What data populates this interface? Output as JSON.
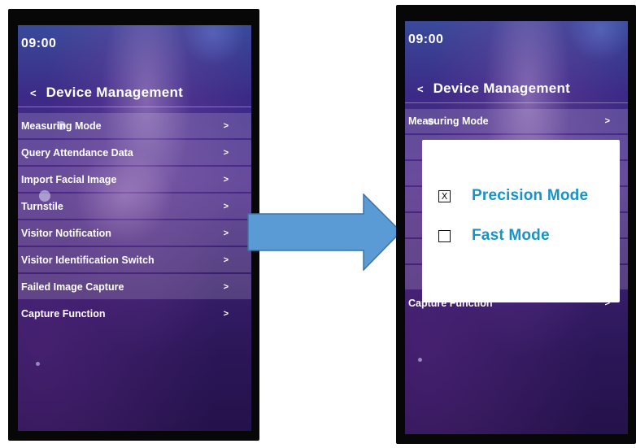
{
  "left_screen": {
    "time": "09:00",
    "back_label": "<",
    "title": "Device Management",
    "menu_items": [
      {
        "label": "Measuring Mode",
        "arrow": ">"
      },
      {
        "label": "Query Attendance Data",
        "arrow": ">"
      },
      {
        "label": "Import Facial Image",
        "arrow": ">"
      },
      {
        "label": "Turnstile",
        "arrow": ">"
      },
      {
        "label": "Visitor Notification",
        "arrow": ">"
      },
      {
        "label": "Visitor Identification Switch",
        "arrow": ">"
      },
      {
        "label": "Failed Image Capture",
        "arrow": ">"
      },
      {
        "label": "Capture Function",
        "arrow": ">"
      }
    ]
  },
  "right_screen": {
    "time": "09:00",
    "back_label": "<",
    "title": "Device Management",
    "menu_items": [
      {
        "label": "Measuring Mode",
        "arrow": ">"
      },
      {
        "label": "Capture Function",
        "arrow": ">"
      }
    ],
    "popup": {
      "options": [
        {
          "label": "Precision Mode",
          "checked": true,
          "mark": "X"
        },
        {
          "label": "Fast Mode",
          "checked": false,
          "mark": ""
        }
      ]
    }
  },
  "colors": {
    "accent_text": "#1793c8",
    "arrow_fill": "#5b9bd5",
    "arrow_stroke": "#41719c",
    "device_frame": "#070707"
  }
}
